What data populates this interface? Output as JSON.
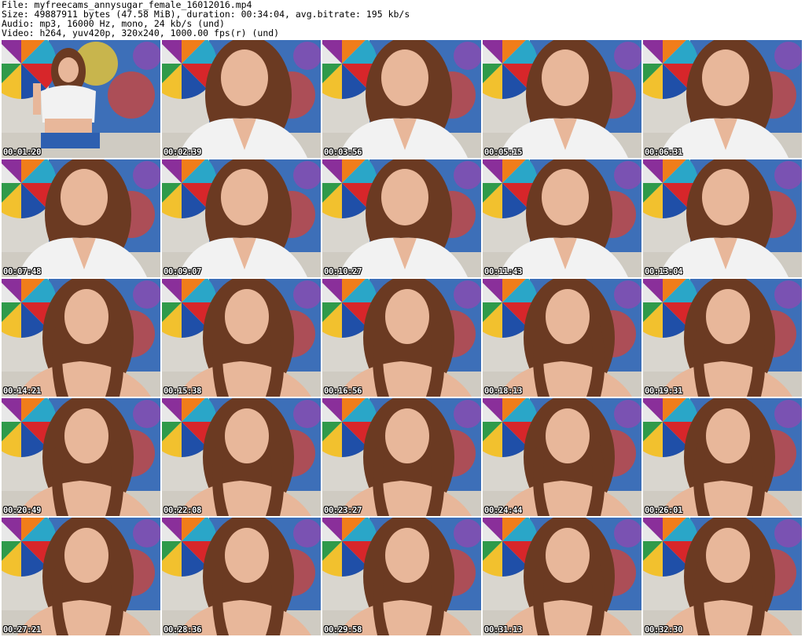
{
  "header": {
    "file": "File: myfreecams_annysugar_female_16012016.mp4",
    "size": "Size: 49887911 bytes (47.58 MiB), duration: 00:34:04, avg.bitrate: 195 kb/s",
    "audio": "Audio: mp3, 16000 Hz, mono, 24 kb/s (und)",
    "video": "Video: h264, yuv420p, 320x240, 1000.00 fps(r) (und)"
  },
  "colors": {
    "background": "#ffffff",
    "timestamp_text": "#ffffff",
    "timestamp_outline": "#000000",
    "wall": "#d9d6cf",
    "hair": "#6b3a22",
    "skin": "#e8b79a",
    "top_white": "#f2f2f2"
  },
  "thumbnails": [
    {
      "time": "00:01:20",
      "scene": "a"
    },
    {
      "time": "00:02:39",
      "scene": "b"
    },
    {
      "time": "00:03:56",
      "scene": "b"
    },
    {
      "time": "00:05:15",
      "scene": "b"
    },
    {
      "time": "00:06:31",
      "scene": "b"
    },
    {
      "time": "00:07:48",
      "scene": "b"
    },
    {
      "time": "00:09:07",
      "scene": "b"
    },
    {
      "time": "00:10:27",
      "scene": "b"
    },
    {
      "time": "00:11:43",
      "scene": "b"
    },
    {
      "time": "00:13:04",
      "scene": "b"
    },
    {
      "time": "00:14:21",
      "scene": "c"
    },
    {
      "time": "00:15:38",
      "scene": "c"
    },
    {
      "time": "00:16:56",
      "scene": "c"
    },
    {
      "time": "00:18:13",
      "scene": "c"
    },
    {
      "time": "00:19:31",
      "scene": "c"
    },
    {
      "time": "00:20:49",
      "scene": "c"
    },
    {
      "time": "00:22:08",
      "scene": "c"
    },
    {
      "time": "00:23:27",
      "scene": "c"
    },
    {
      "time": "00:24:44",
      "scene": "c"
    },
    {
      "time": "00:26:01",
      "scene": "c"
    },
    {
      "time": "00:27:21",
      "scene": "c"
    },
    {
      "time": "00:28:36",
      "scene": "c"
    },
    {
      "time": "00:29:58",
      "scene": "c"
    },
    {
      "time": "00:31:13",
      "scene": "c"
    },
    {
      "time": "00:32:30",
      "scene": "c"
    }
  ]
}
